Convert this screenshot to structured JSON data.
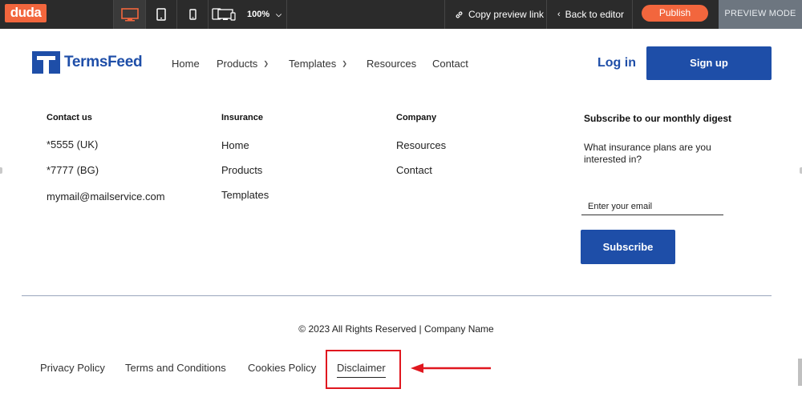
{
  "toolbar": {
    "logo": "duda",
    "zoom": "100%",
    "copy_link": "Copy preview link",
    "back": "Back to editor",
    "publish": "Publish",
    "mode": "PREVIEW MODE",
    "accent_color": "#f2663d"
  },
  "header": {
    "brand": "TermsFeed",
    "nav": [
      "Home",
      "Products",
      "Templates",
      "Resources",
      "Contact"
    ],
    "login": "Log in",
    "signup": "Sign up",
    "brand_color": "#1e4ea8"
  },
  "footer": {
    "contact": {
      "heading": "Contact us",
      "items": [
        "*5555 (UK)",
        "*7777 (BG)",
        "mymail@mailservice.com"
      ]
    },
    "insurance": {
      "heading": "Insurance",
      "items": [
        "Home",
        "Products",
        "Templates"
      ]
    },
    "company": {
      "heading": "Company",
      "items": [
        "Resources",
        "Contact"
      ]
    },
    "subscribe": {
      "heading": "Subscribe to our monthly digest",
      "text": "What insurance plans are you interested in?",
      "placeholder": "Enter your email",
      "button": "Subscribe"
    },
    "copyright": "© 2023 All Rights Reserved | Company Name",
    "legal": [
      "Privacy Policy",
      "Terms and Conditions",
      "Cookies Policy",
      "Disclaimer"
    ],
    "highlight_color": "#e0171f"
  }
}
